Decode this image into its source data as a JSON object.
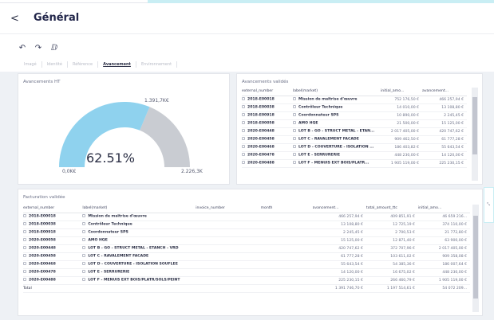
{
  "header": {
    "back": "<",
    "title": "Général"
  },
  "toolbar": {
    "undo": "↶",
    "redo": "↷",
    "extra": "ⅅ"
  },
  "tabs": [
    "Imagé",
    "Identité",
    "Référence",
    "Avancement",
    "Environnement"
  ],
  "colors": {
    "gauge_fill": "#8fd2ee",
    "gauge_rest": "#c9ccd2",
    "accent": "#c9eef4"
  },
  "ht_panel": {
    "title": "Avancements HT",
    "gauge_value": "1.391,7K€",
    "percent": "62.51%",
    "fraction": 0.6251,
    "min": "0,0K€",
    "max": "2.226,3K"
  },
  "av_panel": {
    "title": "Avancements validés",
    "columns": [
      "external_number",
      "label(market)",
      "initial_amo...",
      "avancement..."
    ],
    "rows": [
      [
        "2018-E00018",
        "Mission de maîtrise d'œuvre",
        "752 176,50 €",
        "466 257,94 €"
      ],
      [
        "2018-E00038",
        "Contrôleur Technique",
        "14 010,00 €",
        "13 108,80 €"
      ],
      [
        "2018-E00918",
        "Coordonnateur SPS",
        "10 890,00 €",
        "2 245,45 €"
      ],
      [
        "2018-E00058",
        "AMO HQE",
        "21 500,00 €",
        "15 125,00 €"
      ],
      [
        "2020-E00448",
        "LOT B - GO - STRUCT METAL - ETAN...",
        "2 017 405,00 €",
        "420 747,62 €"
      ],
      [
        "2020-E00458",
        "LOT C - RAVALEMENT FACADE",
        "909 462,50 €",
        "61 777,28 €"
      ],
      [
        "2020-E00468",
        "LOT D - COUVERTURE - ISOLATION ...",
        "186 403,82 €",
        "55 643,54 €"
      ],
      [
        "2020-E00478",
        "LOT E - SERRURERIE",
        "448 230,00 €",
        "14 120,00 €"
      ],
      [
        "2020-E00488",
        "LOT F - MENUIS EXT BOIS/PLATR...",
        "1 905 119,00 €",
        "225 230,15 €"
      ]
    ]
  },
  "fa_panel": {
    "title": "Facturation validée",
    "columns": [
      "external_number",
      "label(market)",
      "invoice_number",
      "month",
      "avancement...",
      "total_amount_ttc",
      "initial_amo..."
    ],
    "rows": [
      [
        "2018-E00018",
        "Mission de maîtrise d'œuvre",
        "",
        "",
        "466 257,94 €",
        "409 851,91 €",
        "46 659 216..."
      ],
      [
        "2018-E00038",
        "Contrôleur Technique",
        "",
        "",
        "13 108,80 €",
        "12 725,19 €",
        "374 110,00 €"
      ],
      [
        "2018-E00918",
        "Coordonnateur SPS",
        "",
        "",
        "2 245,45 €",
        "2 700,53 €",
        "21 772,80 €"
      ],
      [
        "2020-E00058",
        "AMO HQE",
        "",
        "",
        "15 125,00 €",
        "12 871,40 €",
        "63 900,00 €"
      ],
      [
        "2020-E00448",
        "LOT B - GO - STRUCT METAL - ETANCH - VRD",
        "",
        "",
        "420 747,62 €",
        "372 707,96 €",
        "2 017 405,00 €"
      ],
      [
        "2020-E00458",
        "LOT C - RAVALEMENT FACADE",
        "",
        "",
        "61 777,28 €",
        "103 611,02 €",
        "909 358,08 €"
      ],
      [
        "2020-E00468",
        "LOT D - COUVERTURE - ISOLATION SOUFLEE",
        "",
        "",
        "55 643,54 €",
        "54 385,36 €",
        "186 007,64 €"
      ],
      [
        "2020-E00478",
        "LOT E - SERRURERIE",
        "",
        "",
        "14 120,00 €",
        "16 675,02 €",
        "448 230,00 €"
      ],
      [
        "2020-E00488",
        "LOT F - MENUIS EXT BOIS/PLATR/SOLS/PEINT",
        "",
        "",
        "225 230,15 €",
        "266 460,79 €",
        "1 905 119,00 €"
      ]
    ],
    "total": {
      "label": "Total",
      "av": "1 391 746,70 €",
      "ttc": "1 197 514,61 €",
      "init": "54 072 209..."
    }
  },
  "side": {
    "icon": "⤡"
  }
}
